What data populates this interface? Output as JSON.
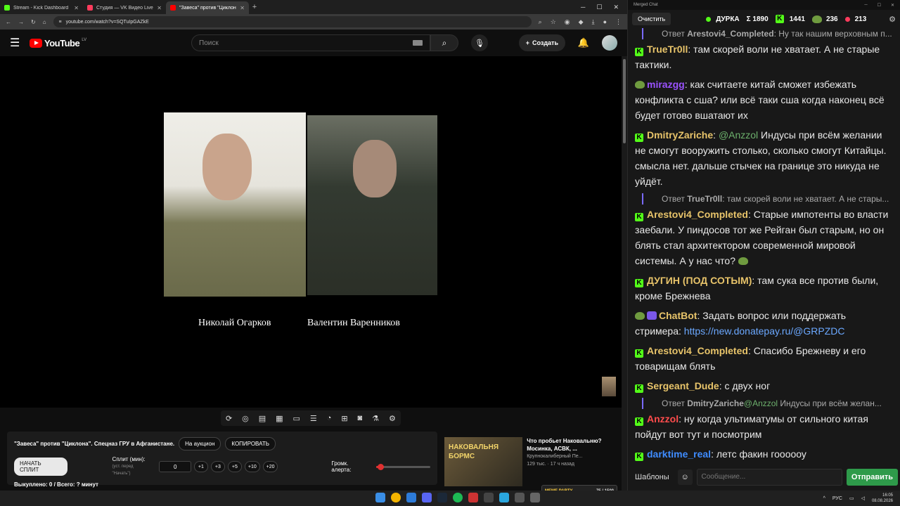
{
  "browser": {
    "tabs": [
      {
        "title": "Stream - Kick Dashboard",
        "color": "#53fc18",
        "active": false
      },
      {
        "title": "Студия — VK Видео Live",
        "color": "#ff3b5c",
        "active": false
      },
      {
        "title": "\"Завеса\" против \"Циклона\". С...",
        "color": "#ff0000",
        "active": true
      }
    ],
    "url": "youtube.com/watch?v=SQTuIpGAZkE"
  },
  "youtube": {
    "logo": "YouTube",
    "country": "LV",
    "search_placeholder": "Поиск",
    "create_label": "Создать",
    "captions": [
      "Николай Огарков",
      "Валентин Варенников"
    ]
  },
  "panel": {
    "title": "\"Завеса\" против \"Циклона\". Спецназ ГРУ в Афганистане.",
    "auction_btn": "На аукцион",
    "copy_btn": "КОПИРОВАТЬ",
    "split_btn": "НАЧАТЬ СПЛИТ",
    "split_label": "Сплит (мин):",
    "split_sub": "(уст. перед \"Начать\")",
    "split_value": "0",
    "steps": [
      "+1",
      "+3",
      "+5",
      "+10",
      "+20"
    ],
    "alert_label": "Громк. алерта:",
    "alert_volume": 0.08,
    "bought": "Выкуплено: 0 / Всего: ? минут"
  },
  "recommendation": {
    "thumb_text": "НАКОВАЛЬНЯ БОРМС",
    "title": "Что пробьет Наковальню? Мосинка, АСВК, ...",
    "channel": "Крупнокалиберный Пе...",
    "meta": "129 тыс. · 17 ч назад"
  },
  "chat": {
    "window_title": "Merged Chat",
    "clear_btn": "Очистить",
    "channel": "ДУРКА",
    "total": "Σ 1890",
    "kick_count": "1441",
    "pepe_count": "236",
    "other_count": "213",
    "messages": [
      {
        "type": "reply",
        "prefix": "Ответ",
        "user": "Arestovi4_Completed",
        "text": ": Ну так нашим верховным п..."
      },
      {
        "type": "msg",
        "badge": "kick",
        "user": "TrueTr0ll",
        "color": "#e8c46a",
        "text": ": там скорей воли не хватает. А не старые тактики."
      },
      {
        "type": "msg",
        "badge": "pepe",
        "user": "mirazgg",
        "color": "#9a52ff",
        "text": ": как считаете китай сможет избежать конфликта с сша? или всё таки сша когда наконец всё будет готово вшатают их"
      },
      {
        "type": "msg",
        "badge": "kick",
        "user": "DmitryZariche",
        "color": "#e8c46a",
        "mention": "@Anzzol",
        "text": " Индусы при всём желании не смогут вооружить столько, сколько смогут Китайцы. смысла нет. дальше стычек на границе это никуда не уйдёт."
      },
      {
        "type": "reply",
        "prefix": "Ответ",
        "user": "TrueTr0ll",
        "text": ": там скорей воли не хватает. А не стары..."
      },
      {
        "type": "msg",
        "badge": "kick",
        "user": "Arestovi4_Completed",
        "color": "#e8c46a",
        "text": ": Старые импотенты во власти заебали. У пиндосов тот же Рейган был старым, но он блять стал архитектором современной мировой системы. А у нас что?"
      },
      {
        "type": "msg",
        "badge": "kick",
        "user": "ДУГИН (ПОД СОТЫМ)",
        "color": "#e8c46a",
        "text": ": там сука все против были, кроме Брежнева"
      },
      {
        "type": "msg",
        "badge": "bot",
        "user": "ChatBot",
        "color": "#e8c46a",
        "text": ": Задать вопрос или поддержать стримера: ",
        "link": "https://new.donatepay.ru/@GRPZDC"
      },
      {
        "type": "msg",
        "badge": "kick",
        "user": "Arestovi4_Completed",
        "color": "#e8c46a",
        "text": ": Спасибо Брежневу и его товарищам блять"
      },
      {
        "type": "msg",
        "badge": "kick",
        "user": "Sergeant_Dude",
        "color": "#e8c46a",
        "text": ": с двух ног"
      },
      {
        "type": "reply",
        "prefix": "Ответ",
        "user": "DmitryZariche",
        "mention": "@Anzzol",
        "text": " Индусы при всём желан..."
      },
      {
        "type": "msg",
        "badge": "kick",
        "user": "Anzzol",
        "color": "#ff4c4c",
        "text": ": ну когда ультиматумы от сильного китая пойдут вот тут и посмотрим"
      },
      {
        "type": "msg",
        "badge": "kick",
        "user": "darktime_real",
        "color": "#3f8cff",
        "text": ": летс факин гоооооу"
      }
    ],
    "templates_btn": "Шаблоны",
    "input_placeholder": "Сообщение...",
    "send_btn": "Отправить"
  },
  "taskbar": {
    "widget_text": "МЕМЕ PARTY",
    "widget_counter": "75 / 1500",
    "lang": "РУС",
    "time": "16:05",
    "date": "08.08.2026"
  }
}
